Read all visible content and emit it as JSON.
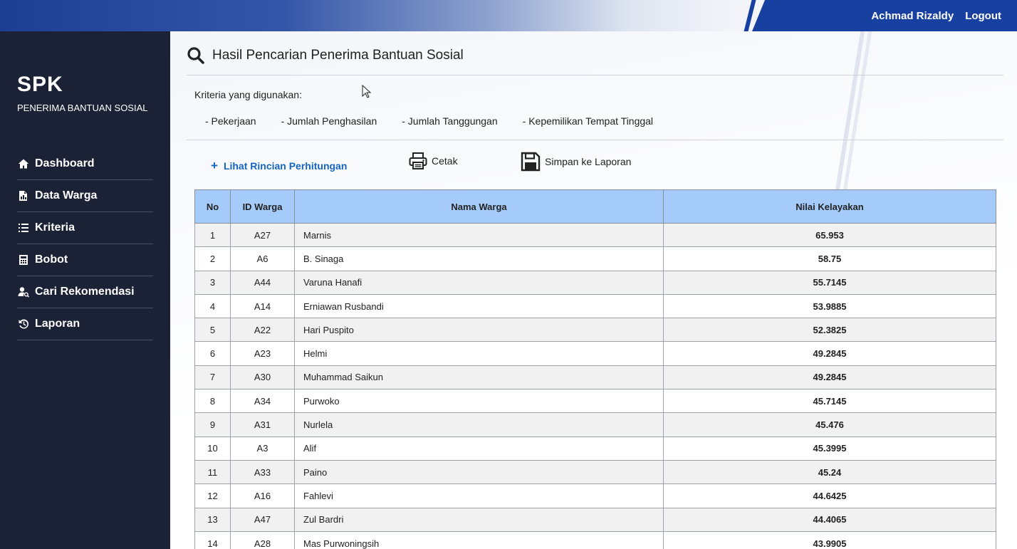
{
  "topbar": {
    "user_name": "Achmad Rizaldy",
    "logout": "Logout"
  },
  "sidebar": {
    "brand_title": "SPK",
    "brand_subtitle": "PENERIMA BANTUAN SOSIAL",
    "items": [
      {
        "label": "Dashboard",
        "icon": "home-icon"
      },
      {
        "label": "Data Warga",
        "icon": "document-chart-icon"
      },
      {
        "label": "Kriteria",
        "icon": "list-icon"
      },
      {
        "label": "Bobot",
        "icon": "calculator-icon"
      },
      {
        "label": "Cari Rekomendasi",
        "icon": "user-search-icon"
      },
      {
        "label": "Laporan",
        "icon": "history-icon"
      }
    ]
  },
  "main": {
    "title": "Hasil Pencarian Penerima Bantuan Sosial",
    "criteria_label": "Kriteria yang digunakan:",
    "criteria": [
      "- Pekerjaan",
      "- Jumlah Penghasilan",
      "- Jumlah Tanggungan",
      "- Kepemilikan Tempat Tinggal"
    ],
    "actions": {
      "detail": "Lihat Rincian Perhitungan",
      "print": "Cetak",
      "save": "Simpan ke Laporan"
    },
    "table": {
      "headers": [
        "No",
        "ID Warga",
        "Nama Warga",
        "Nilai Kelayakan"
      ],
      "rows": [
        [
          "1",
          "A27",
          "Marnis",
          "65.953"
        ],
        [
          "2",
          "A6",
          "B. Sinaga",
          "58.75"
        ],
        [
          "3",
          "A44",
          "Varuna Hanafi",
          "55.7145"
        ],
        [
          "4",
          "A14",
          "Erniawan Rusbandi",
          "53.9885"
        ],
        [
          "5",
          "A22",
          "Hari Puspito",
          "52.3825"
        ],
        [
          "6",
          "A23",
          "Helmi",
          "49.2845"
        ],
        [
          "7",
          "A30",
          "Muhammad Saikun",
          "49.2845"
        ],
        [
          "8",
          "A34",
          "Purwoko",
          "45.7145"
        ],
        [
          "9",
          "A31",
          "Nurlela",
          "45.476"
        ],
        [
          "10",
          "A3",
          "Alif",
          "45.3995"
        ],
        [
          "11",
          "A33",
          "Paino",
          "45.24"
        ],
        [
          "12",
          "A16",
          "Fahlevi",
          "44.6425"
        ],
        [
          "13",
          "A47",
          "Zul Bardri",
          "44.4065"
        ],
        [
          "14",
          "A28",
          "Mas Purwoningsih",
          "43.9905"
        ]
      ]
    }
  }
}
